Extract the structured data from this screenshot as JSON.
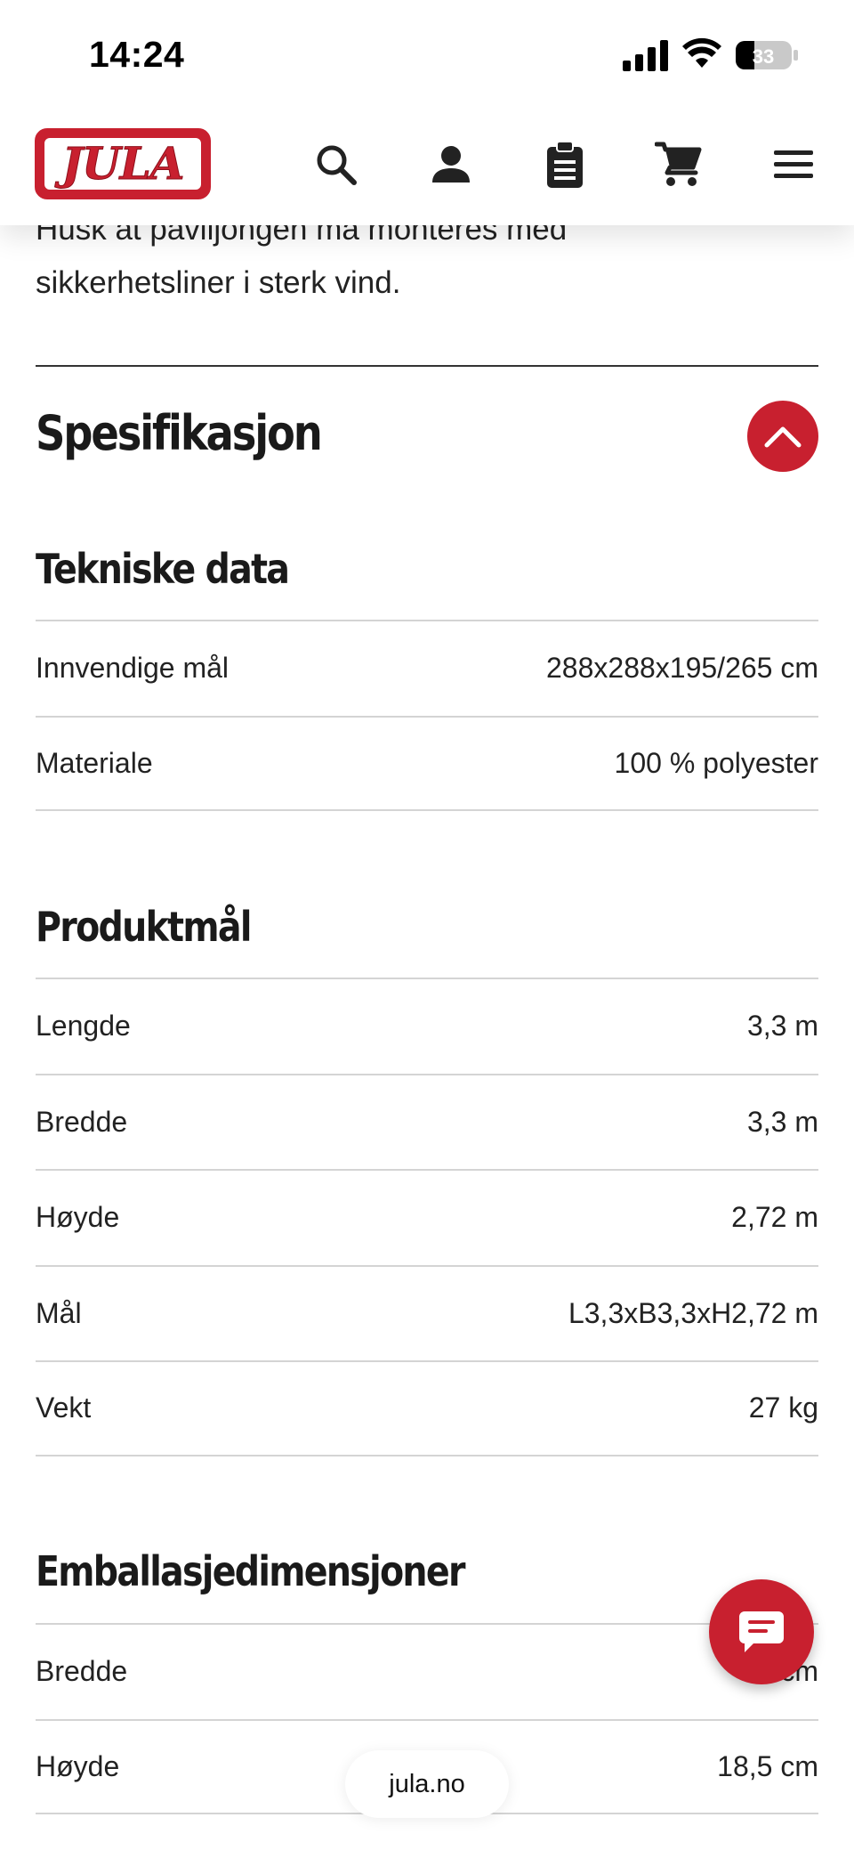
{
  "status_bar": {
    "time": "14:24",
    "battery_level": "33"
  },
  "header": {
    "logo_text": "JULA",
    "icons": [
      "search-icon",
      "user-icon",
      "clipboard-icon",
      "cart-icon",
      "menu-icon"
    ]
  },
  "intro": {
    "line1": "Husk at paviljongen må monteres med",
    "line2": "sikkerhetsliner i sterk vind."
  },
  "spec": {
    "title": "Spesifikasjon",
    "toggle_icon": "chevron-up-icon"
  },
  "sections": {
    "tekniske": {
      "title": "Tekniske data",
      "rows": [
        {
          "label": "Innvendige mål",
          "value": "288x288x195/265 cm"
        },
        {
          "label": "Materiale",
          "value": "100 % polyester"
        }
      ]
    },
    "produktmal": {
      "title": "Produktmål",
      "rows": [
        {
          "label": "Lengde",
          "value": "3,3 m"
        },
        {
          "label": "Bredde",
          "value": "3,3 m"
        },
        {
          "label": "Høyde",
          "value": "2,72 m"
        },
        {
          "label": "Mål",
          "value": "L3,3xB3,3xH2,72 m"
        },
        {
          "label": "Vekt",
          "value": "27 kg"
        }
      ]
    },
    "emballasje": {
      "title": "Emballasjedimensjoner",
      "rows": [
        {
          "label": "Bredde",
          "value": "24 cm"
        },
        {
          "label": "Høyde",
          "value": "18,5 cm"
        }
      ]
    }
  },
  "browser": {
    "url": "jula.no"
  },
  "colors": {
    "brand_red": "#c8202f",
    "divider": "#d4d4d4"
  }
}
